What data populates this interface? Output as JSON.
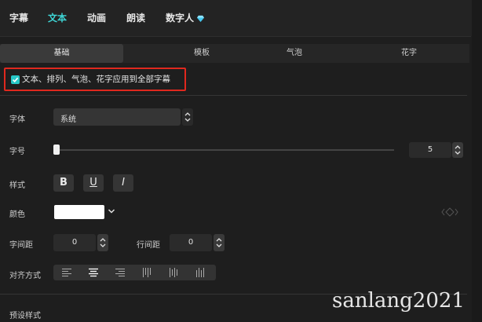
{
  "top_tabs": [
    {
      "label": "字幕",
      "active": false
    },
    {
      "label": "文本",
      "active": true
    },
    {
      "label": "动画",
      "active": false
    },
    {
      "label": "朗读",
      "active": false
    },
    {
      "label": "数字人",
      "active": false,
      "icon": "diamond-icon"
    }
  ],
  "sub_tabs": [
    {
      "label": "基础",
      "active": true
    },
    {
      "label": "模板",
      "active": false
    },
    {
      "label": "气泡",
      "active": false
    },
    {
      "label": "花字",
      "active": false
    }
  ],
  "apply_all": {
    "label": "文本、排列、气泡、花字应用到全部字幕",
    "checked": true
  },
  "font": {
    "label": "字体",
    "value": "系统"
  },
  "size": {
    "label": "字号",
    "value": "5",
    "slider_fraction": 0.0
  },
  "style": {
    "label": "样式",
    "bold": "B",
    "underline": "U",
    "italic": "I"
  },
  "color": {
    "label": "颜色",
    "value": "#ffffff"
  },
  "letter_spacing": {
    "label": "字间距",
    "value": "0"
  },
  "line_spacing": {
    "label": "行间距",
    "value": "0"
  },
  "alignment": {
    "label": "对齐方式",
    "active_index": 1
  },
  "preset": {
    "label": "预设样式"
  },
  "watermark": "sanlang2021",
  "colors": {
    "accent": "#3ed6d6",
    "highlight_box": "#e0281e"
  }
}
